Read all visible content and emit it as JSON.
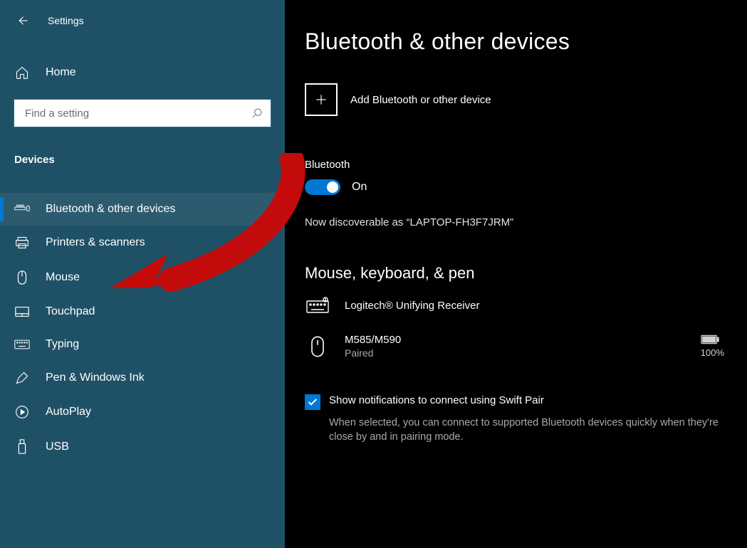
{
  "app": {
    "title": "Settings"
  },
  "sidebar": {
    "home_label": "Home",
    "search_placeholder": "Find a setting",
    "section_label": "Devices",
    "items": [
      {
        "label": "Bluetooth & other devices"
      },
      {
        "label": "Printers & scanners"
      },
      {
        "label": "Mouse"
      },
      {
        "label": "Touchpad"
      },
      {
        "label": "Typing"
      },
      {
        "label": "Pen & Windows Ink"
      },
      {
        "label": "AutoPlay"
      },
      {
        "label": "USB"
      }
    ]
  },
  "main": {
    "title": "Bluetooth & other devices",
    "add_device_label": "Add Bluetooth or other device",
    "bluetooth_label": "Bluetooth",
    "toggle_state_label": "On",
    "discoverable_text": "Now discoverable as “LAPTOP-FH3F7JRM”",
    "section_heading": "Mouse, keyboard, & pen",
    "devices": [
      {
        "name": "Logitech® Unifying Receiver",
        "status": ""
      },
      {
        "name": "M585/M590",
        "status": "Paired",
        "battery_pct": "100%"
      }
    ],
    "swift_pair_label": "Show notifications to connect using Swift Pair",
    "swift_pair_desc": "When selected, you can connect to supported Bluetooth devices quickly when they're close by and in pairing mode."
  }
}
